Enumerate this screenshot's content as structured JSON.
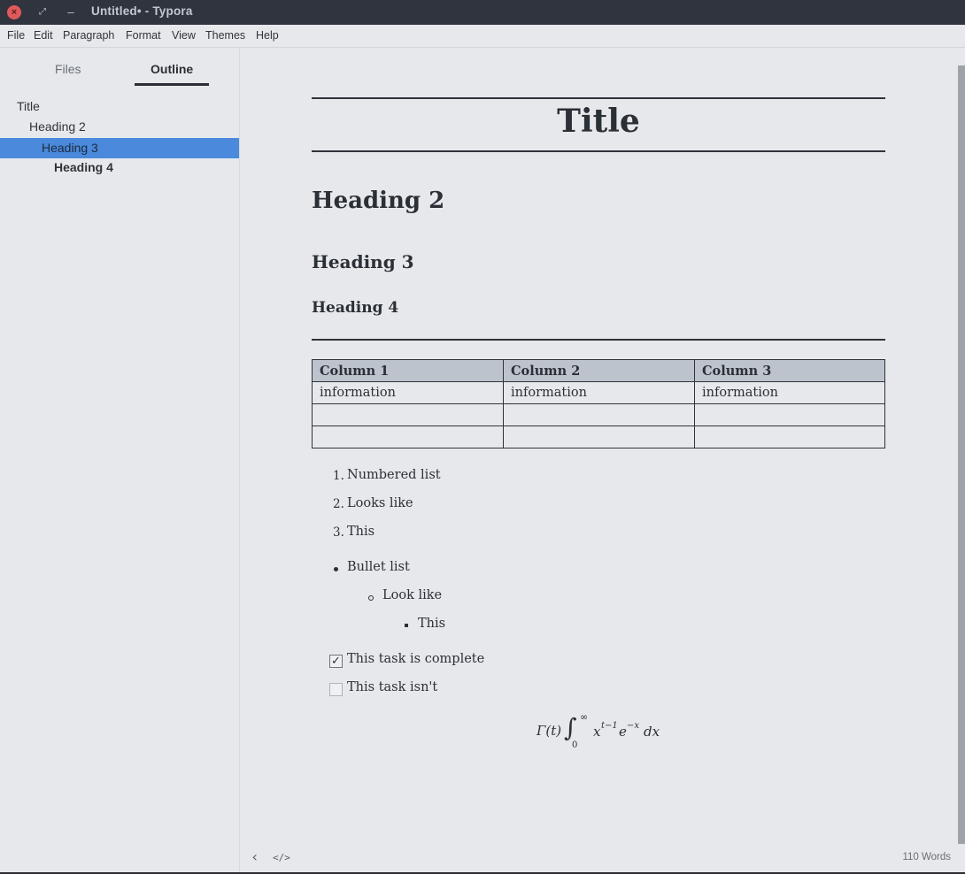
{
  "window": {
    "title": "Untitled• - Typora",
    "close_icon": "×",
    "restore_icon": "⤢",
    "minimize_icon": "–"
  },
  "menu": [
    "File",
    "Edit",
    "Paragraph",
    "Format",
    "View",
    "Themes",
    "Help"
  ],
  "sidebar": {
    "tabs": {
      "files": "Files",
      "outline": "Outline"
    },
    "outline": [
      {
        "label": "Title",
        "level": 1,
        "active": false
      },
      {
        "label": "Heading 2",
        "level": 2,
        "active": false
      },
      {
        "label": "Heading 3",
        "level": 3,
        "active": true
      },
      {
        "label": "Heading 4",
        "level": 4,
        "active": false
      }
    ]
  },
  "document": {
    "title": "Title",
    "h2": "Heading 2",
    "h3": "Heading 3",
    "h4": "Heading 4",
    "table": {
      "headers": [
        "Column 1",
        "Column 2",
        "Column 3"
      ],
      "rows": [
        [
          "information",
          "information",
          "information"
        ],
        [
          "",
          "",
          ""
        ],
        [
          "",
          "",
          ""
        ]
      ]
    },
    "numbered": [
      "Numbered list",
      "Looks like",
      "This"
    ],
    "numbered_markers": [
      "1.",
      "2.",
      "3."
    ],
    "bullets": [
      "Bullet list",
      "Look like",
      "This"
    ],
    "tasks": [
      {
        "label": "This task is complete",
        "checked": true
      },
      {
        "label": "This task isn't",
        "checked": false
      }
    ],
    "checkmark": "✓",
    "math": {
      "gamma": "Γ(t)",
      "integral": "∫",
      "upper": "∞",
      "lower": "0",
      "x": "x",
      "x_exp": "t−1",
      "e": "e",
      "e_exp": "−x",
      "dx": "dx"
    }
  },
  "footer": {
    "back_icon": "‹",
    "source_icon": "</>",
    "word_count": "110 Words"
  },
  "colors": {
    "titlebar": "#2f343f",
    "background": "#e6e8ec",
    "accent": "#4a89dc",
    "table_header": "#bdc3cc",
    "close_button": "#e05a5a"
  }
}
